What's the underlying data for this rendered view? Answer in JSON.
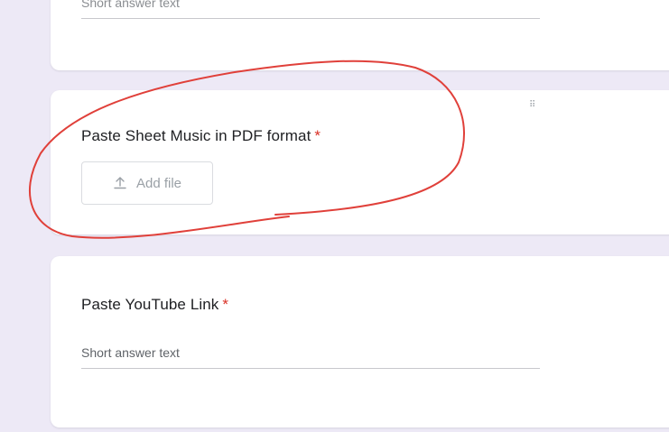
{
  "top_card": {
    "placeholder": "Short answer text"
  },
  "upload_question": {
    "title": "Paste Sheet Music in PDF format",
    "required_mark": "*",
    "drag_handle": "⠿",
    "add_file_label": "Add file"
  },
  "youtube_question": {
    "title": "Paste YouTube Link",
    "required_mark": "*",
    "placeholder": "Short answer text"
  },
  "colors": {
    "background": "#ede9f6",
    "required": "#d93025",
    "annotation": "#e0403a"
  },
  "icons": {
    "add_file": "upload-icon"
  }
}
